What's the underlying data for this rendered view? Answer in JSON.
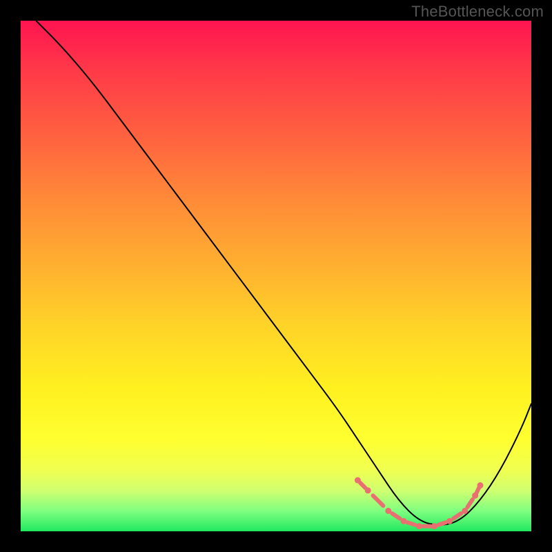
{
  "watermark": "TheBottleneck.com",
  "chart_data": {
    "type": "line",
    "title": "",
    "xlabel": "",
    "ylabel": "",
    "xlim": [
      0,
      100
    ],
    "ylim": [
      0,
      100
    ],
    "background_gradient": {
      "top_color": "#ff1450",
      "bottom_color": "#20e860",
      "description": "red-to-green heatmap gradient (red=high bottleneck, green=low)"
    },
    "series": [
      {
        "name": "bottleneck-curve",
        "description": "Black V-shaped curve showing bottleneck percentage vs component balance; minimum near x≈78",
        "x": [
          3,
          8,
          14,
          20,
          26,
          32,
          38,
          44,
          50,
          56,
          62,
          66,
          70,
          74,
          78,
          82,
          86,
          90,
          94,
          98,
          100
        ],
        "values": [
          100,
          95,
          88,
          80,
          72,
          64,
          56,
          48,
          40,
          32,
          24,
          18,
          12,
          6,
          2,
          1,
          2,
          6,
          12,
          20,
          25
        ]
      },
      {
        "name": "highlight-points",
        "description": "Salmon dashed/dotted markers near the curve minimum",
        "x": [
          66,
          68,
          72,
          75,
          78,
          81,
          84,
          87,
          89,
          90
        ],
        "values": [
          10,
          8,
          4,
          2,
          1,
          1,
          2,
          4,
          7,
          9
        ]
      }
    ]
  }
}
